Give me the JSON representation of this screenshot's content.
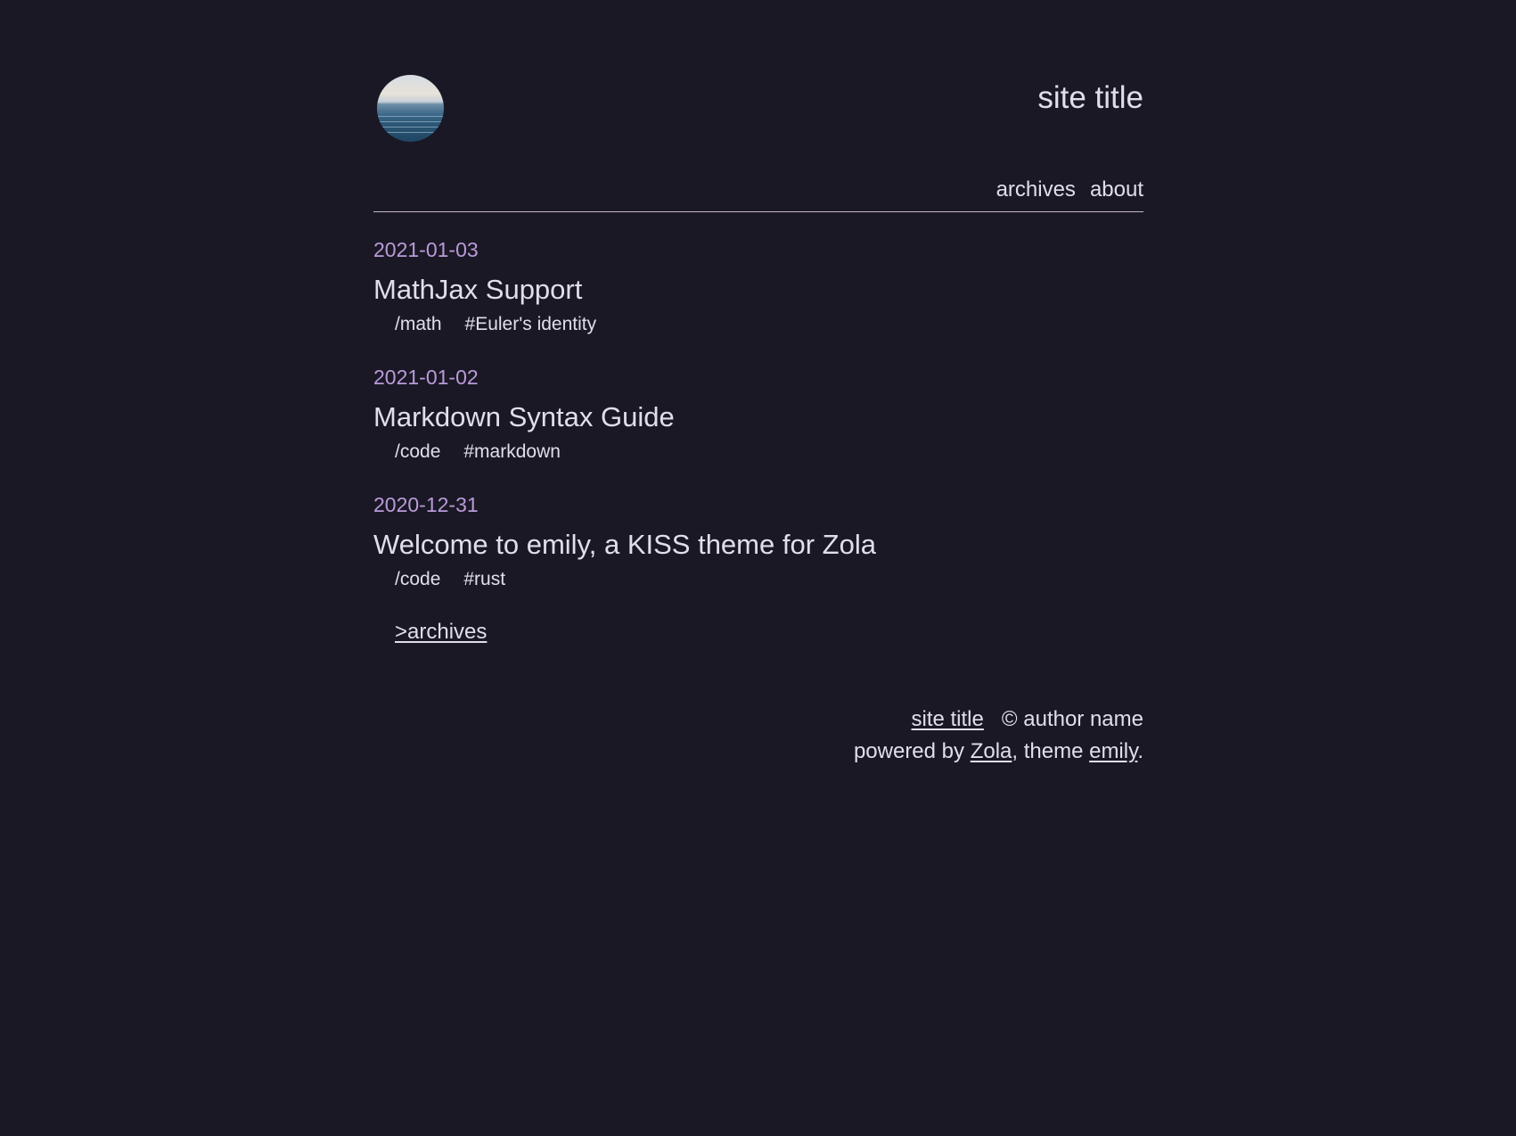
{
  "header": {
    "site_title": "site title",
    "avatar_icon": "ocean-horizon-avatar"
  },
  "nav": {
    "items": [
      "archives",
      "about"
    ]
  },
  "posts": [
    {
      "date": "2021-01-03",
      "title": "MathJax Support",
      "category": "/math",
      "tag": "#Euler's identity"
    },
    {
      "date": "2021-01-02",
      "title": "Markdown Syntax Guide",
      "category": "/code",
      "tag": "#markdown"
    },
    {
      "date": "2020-12-31",
      "title": "Welcome to emily, a KISS theme for Zola",
      "category": "/code",
      "tag": "#rust"
    }
  ],
  "more_link": ">archives",
  "footer": {
    "site_link": "site title",
    "copyright": "© author name",
    "powered_prefix": "powered by ",
    "engine_link": "Zola",
    "theme_prefix": ", theme ",
    "theme_link": "emily",
    "suffix": "."
  },
  "colors": {
    "background": "#1a1825",
    "text": "#e0dfe8",
    "date_accent": "#b99bd8",
    "divider": "#c9b7c7"
  }
}
